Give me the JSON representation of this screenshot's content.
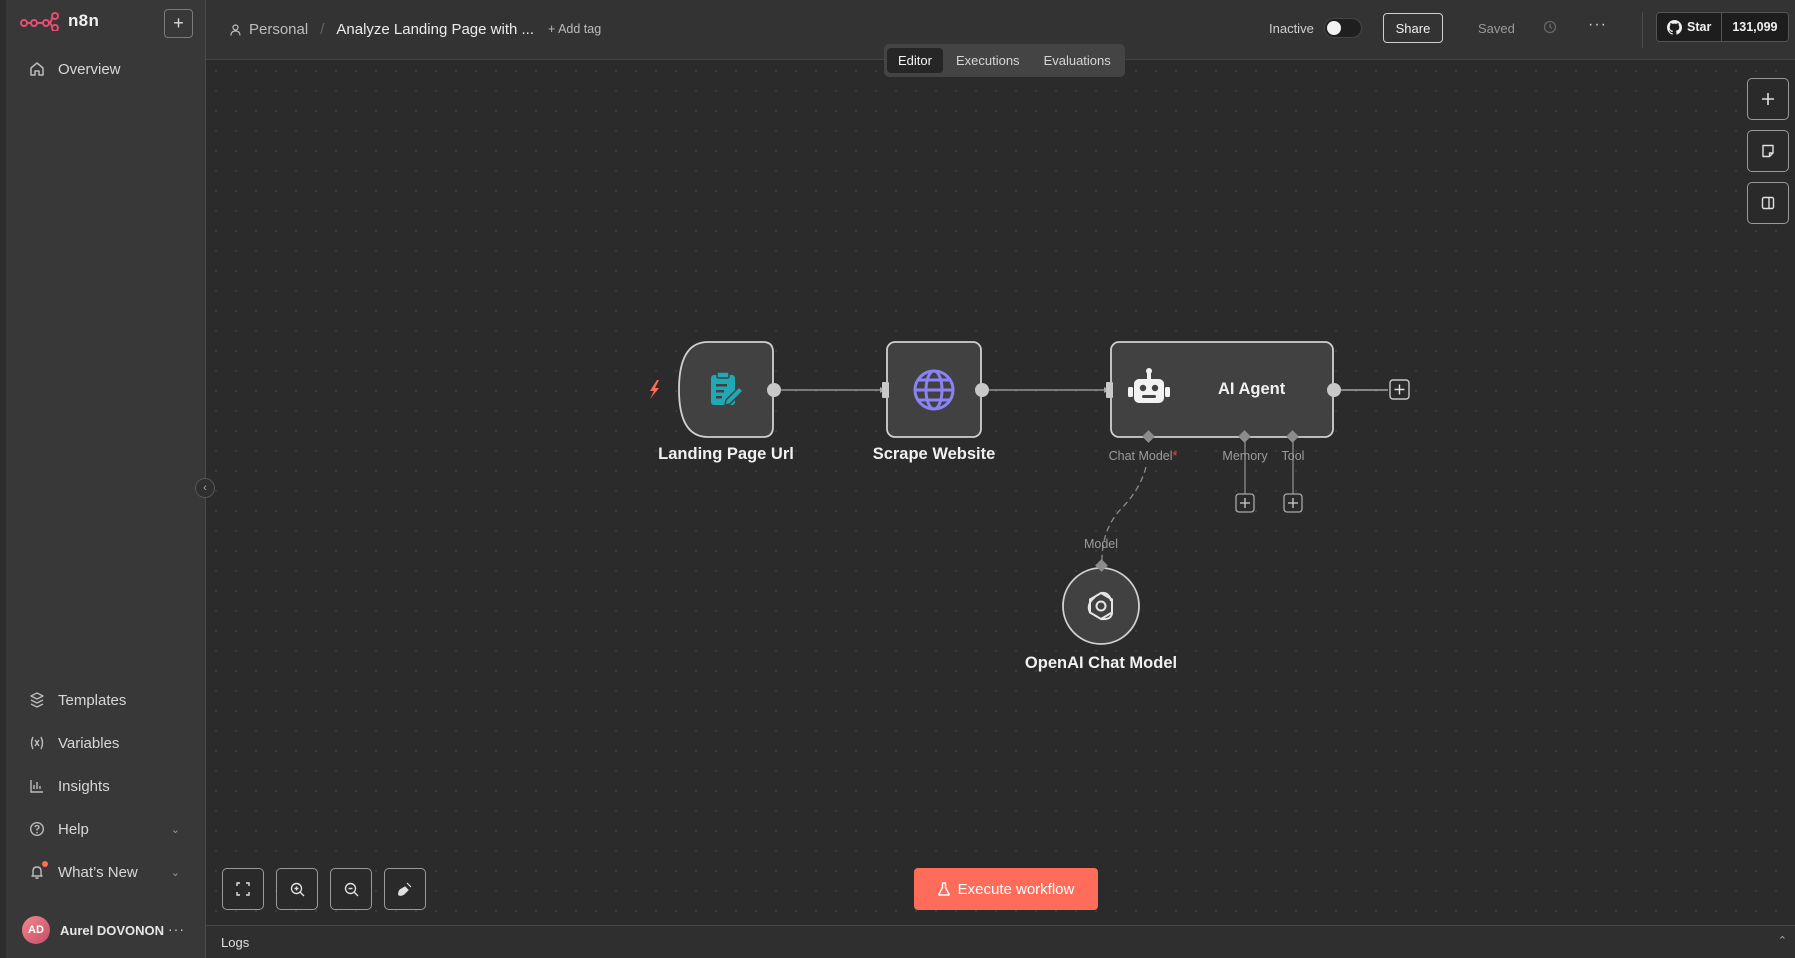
{
  "app": {
    "name": "n8n"
  },
  "sidebar": {
    "top_items": [
      {
        "label": "Overview",
        "icon": "home-icon"
      }
    ],
    "bottom_items": [
      {
        "label": "Templates",
        "icon": "box-icon"
      },
      {
        "label": "Variables",
        "icon": "variable-icon"
      },
      {
        "label": "Insights",
        "icon": "chart-icon"
      },
      {
        "label": "Help",
        "icon": "help-icon"
      },
      {
        "label": "What’s New",
        "icon": "bell-icon"
      }
    ],
    "user": {
      "initials": "AD",
      "name": "Aurel DOVONON"
    }
  },
  "header": {
    "project": "Personal",
    "workflow_title": "Analyze Landing Page with ...",
    "add_tag": "+ Add tag",
    "status_label": "Inactive",
    "share": "Share",
    "saved": "Saved",
    "github": {
      "star": "Star",
      "count": "131,099"
    }
  },
  "tabs": [
    {
      "label": "Editor",
      "active": true
    },
    {
      "label": "Executions",
      "active": false
    },
    {
      "label": "Evaluations",
      "active": false
    }
  ],
  "workflow": {
    "nodes": [
      {
        "id": "landing",
        "label": "Landing Page Url",
        "icon": "form-icon"
      },
      {
        "id": "scrape",
        "label": "Scrape Website",
        "icon": "globe-icon"
      },
      {
        "id": "agent",
        "label": "AI Agent",
        "icon": "robot-icon"
      },
      {
        "id": "openai",
        "label": "OpenAI Chat Model",
        "icon": "openai-icon"
      }
    ],
    "ports": {
      "chat_model": "Chat Model",
      "memory": "Memory",
      "tool": "Tool",
      "model": "Model"
    }
  },
  "footer": {
    "execute": "Execute workflow",
    "logs": "Logs"
  },
  "colors": {
    "brand": "#ea4b71",
    "execute": "#ff6d5a",
    "trigger": "#ff6d5a",
    "form_icon": "#1fa9b4",
    "globe_icon": "#8b82f5"
  }
}
